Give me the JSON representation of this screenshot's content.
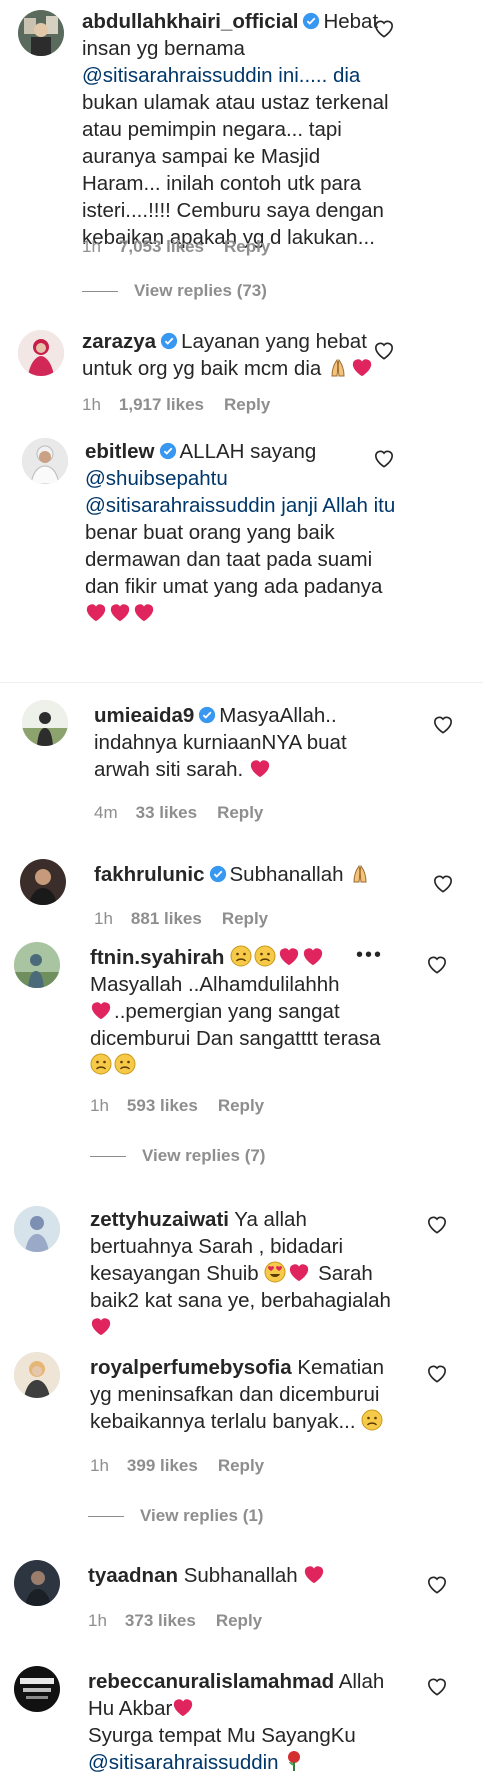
{
  "colors": {
    "text": "#262626",
    "meta": "#8e8e8e",
    "mention": "#00376b",
    "verified": "#3897f0",
    "heart_emoji": "#e0245e"
  },
  "comments": [
    {
      "username": "abdullahkhairi_official",
      "verified": true,
      "lines": [
        "Hebat",
        "insan yg bernama",
        "@sitisarahraissuddin ini..... dia",
        "bukan ulamak atau ustaz terkenal",
        "atau pemimpin negara... tapi",
        "auranya sampai ke Masjid",
        "Haram... inilah contoh utk para",
        "isteri....!!!! Cemburu saya dengan",
        "kebaikan apakah yg d lakukan..."
      ],
      "time": "1h",
      "likes": "7,053 likes",
      "reply": "Reply",
      "view_replies": "View replies (73)"
    },
    {
      "username": "zarazya",
      "verified": true,
      "lines": [
        "Layanan yang hebat",
        "untuk org yg baik mcm dia"
      ],
      "time": "1h",
      "likes": "1,917 likes",
      "reply": "Reply"
    },
    {
      "username": "ebitlew",
      "verified": true,
      "lines": [
        "ALLAH sayang",
        "@shuibsepahtu",
        "@sitisarahraissuddin janji Allah itu",
        "benar buat orang yang baik",
        "dermawan dan taat pada suami",
        "dan fikir umat yang ada padanya"
      ]
    },
    {
      "username": "umieaida9",
      "verified": true,
      "lines": [
        "MasyaAllah..",
        "indahnya kurniaanNYA buat",
        "arwah siti sarah."
      ],
      "time": "4m",
      "likes": "33 likes",
      "reply": "Reply"
    },
    {
      "username": "fakhrulunic",
      "verified": true,
      "lines": [
        "Subhanallah"
      ],
      "time": "1h",
      "likes": "881 likes",
      "reply": "Reply"
    },
    {
      "username": "ftnin.syahirah",
      "verified": false,
      "more": "•••",
      "lines": [
        "Masyallah ..Alhamdulilahhh",
        "..pemergian yang sangat",
        "dicemburui Dan sangatttt terasa"
      ],
      "time": "1h",
      "likes": "593 likes",
      "reply": "Reply",
      "view_replies": "View replies (7)"
    },
    {
      "username": "zettyhuzaiwati",
      "verified": false,
      "lines": [
        "Ya allah",
        "bertuahnya Sarah , bidadari",
        "kesayangan Shuib",
        "Sarah",
        "baik2 kat sana ye, berbahagialah"
      ]
    },
    {
      "username": "royalperfumebysofia",
      "verified": false,
      "lines": [
        "Kematian",
        "yg meninsafkan dan dicemburui",
        "kebaikannya terlalu banyak..."
      ],
      "time": "1h",
      "likes": "399 likes",
      "reply": "Reply",
      "view_replies": "View replies (1)"
    },
    {
      "username": "tyaadnan",
      "verified": false,
      "lines": [
        "Subhanallah"
      ],
      "time": "1h",
      "likes": "373 likes",
      "reply": "Reply"
    },
    {
      "username": "rebeccanuralislamahmad",
      "verified": false,
      "lines": [
        "Allah",
        "Hu Akbar",
        "Syurga tempat Mu SayangKu",
        "@sitisarahraissuddin"
      ]
    }
  ]
}
